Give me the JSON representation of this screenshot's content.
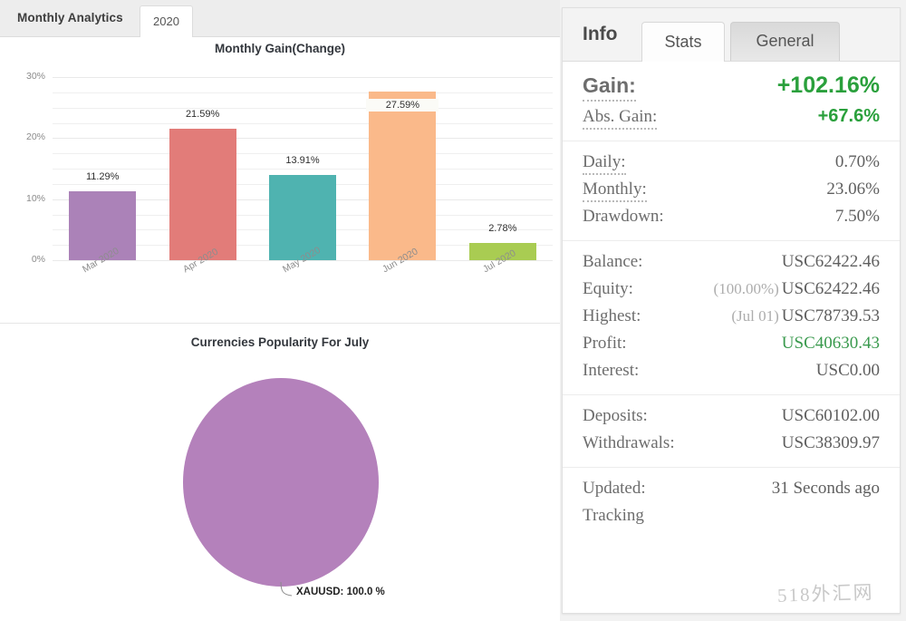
{
  "left": {
    "header_title": "Monthly Analytics",
    "year_tab": "2020"
  },
  "right": {
    "info_heading": "Info",
    "tab_stats": "Stats",
    "tab_general": "General",
    "groups": [
      {
        "rows": [
          {
            "label": "Gain:",
            "value": "+102.16%"
          },
          {
            "label": "Abs. Gain:",
            "value": "+67.6%"
          }
        ]
      },
      {
        "rows": [
          {
            "label": "Daily:",
            "value": "0.70%"
          },
          {
            "label": "Monthly:",
            "value": "23.06%"
          },
          {
            "label": "Drawdown:",
            "value": "7.50%"
          }
        ]
      },
      {
        "rows": [
          {
            "label": "Balance:",
            "value": "USC62422.46"
          },
          {
            "label": "Equity:",
            "paren": "(100.00%)",
            "value": "USC62422.46"
          },
          {
            "label": "Highest:",
            "paren": "(Jul 01)",
            "value": "USC78739.53"
          },
          {
            "label": "Profit:",
            "value": "USC40630.43"
          },
          {
            "label": "Interest:",
            "value": "USC0.00"
          }
        ]
      },
      {
        "rows": [
          {
            "label": "Deposits:",
            "value": "USC60102.00"
          },
          {
            "label": "Withdrawals:",
            "value": "USC38309.97"
          }
        ]
      },
      {
        "rows": [
          {
            "label": "Updated:",
            "value": "31 Seconds ago"
          },
          {
            "label": "Tracking",
            "value": ""
          }
        ]
      }
    ]
  },
  "watermark": "518外汇网",
  "colors": {
    "positive_green": "#2aa03c",
    "profit_green": "#3a9a4e",
    "bar_purple": "#ab82b8",
    "bar_red": "#e27c79",
    "bar_teal": "#4fb3b0",
    "bar_orange": "#fab98a",
    "bar_green": "#a9cc52"
  },
  "chart_data": [
    {
      "type": "bar",
      "title": "Monthly Gain(Change)",
      "xlabel": "",
      "ylabel": "",
      "categories": [
        "Mar 2020",
        "Apr 2020",
        "May 2020",
        "Jun 2020",
        "Jul 2020"
      ],
      "values": [
        11.29,
        21.59,
        13.91,
        27.59,
        2.78
      ],
      "value_labels": [
        "11.29%",
        "21.59%",
        "13.91%",
        "27.59%",
        "2.78%"
      ],
      "bar_colors": [
        "#ab82b8",
        "#e27c79",
        "#4fb3b0",
        "#fab98a",
        "#a9cc52"
      ],
      "ylim": [
        0,
        30
      ],
      "yticks": [
        0,
        10,
        20,
        30
      ],
      "ytick_labels": [
        "0%",
        "10%",
        "20%",
        "30%"
      ],
      "grid": true,
      "minor_grid_step": 2.5,
      "legend": "none"
    },
    {
      "type": "pie",
      "title": "Currencies Popularity For July",
      "labels": [
        "XAUUSD"
      ],
      "values": [
        100.0
      ],
      "slice_labels": [
        "XAUUSD: 100.0 %"
      ],
      "slice_colors": [
        "#b481bb"
      ],
      "legend": "none"
    }
  ]
}
